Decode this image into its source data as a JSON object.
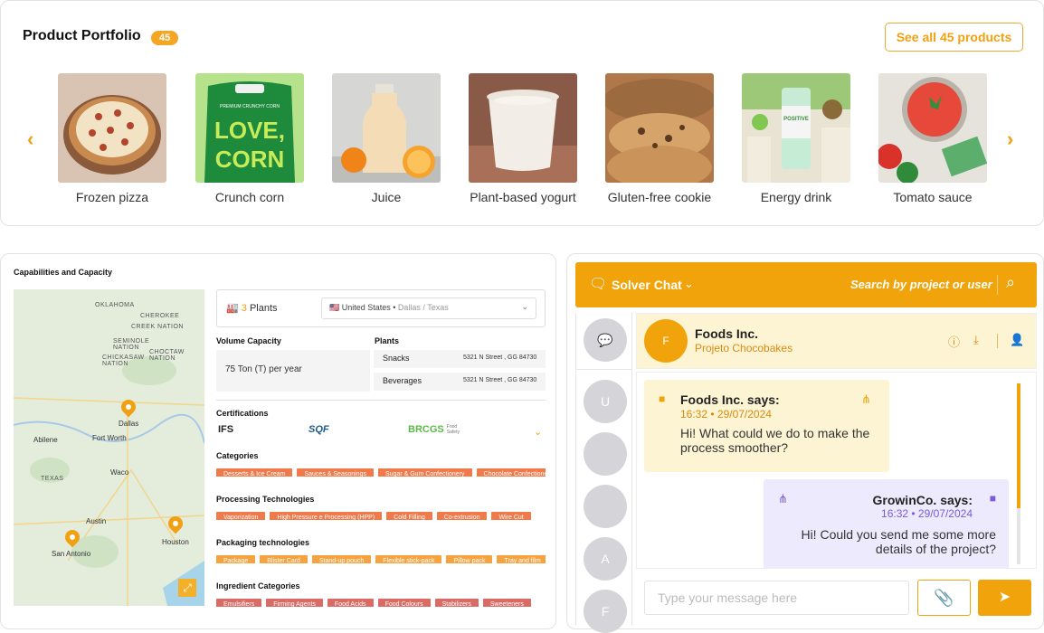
{
  "portfolio": {
    "title": "Product Portfolio",
    "count": "45",
    "see_all": "See all 45 products",
    "products": [
      {
        "label": "Frozen pizza"
      },
      {
        "label": "Crunch corn"
      },
      {
        "label": "Juice"
      },
      {
        "label": "Plant-based yogurt"
      },
      {
        "label": "Gluten-free cookie"
      },
      {
        "label": "Energy drink"
      },
      {
        "label": "Tomato sauce"
      }
    ],
    "corn_pack_text": "LOVE, CORN",
    "corn_pack_small": "PREMIUM CRUNCHY CORN",
    "drink_can_text": "POSITIVE BEVERAGE"
  },
  "capabilities": {
    "title": "Capabilities and Capacity",
    "plants_count": "3",
    "plants_label": "Plants",
    "country": "United States",
    "country_sub": "Dallas / Texas",
    "volume_header": "Volume Capacity",
    "volume_value": "75 Ton (T) per year",
    "plants_header": "Plants",
    "plants": [
      {
        "name": "Snacks",
        "addr": "5321 N  Street , GG 84730"
      },
      {
        "name": "Beverages",
        "addr": "5321 N  Street , GG 84730"
      }
    ],
    "certifications_header": "Certifications",
    "certifications": [
      "IFS",
      "SQF",
      "BRCGS"
    ],
    "brcgs_sub": "Food Safety",
    "categories_header": "Categories",
    "categories": [
      "Desserts & Ice Cream",
      "Sauces & Seasonings",
      "Sugar & Gum Confectionery",
      "Chocolate Confectionery"
    ],
    "processing_header": "Processing Technologies",
    "processing": [
      "Vaporization",
      "High Pressure e Processing (HPP)",
      "Cold Filling",
      "Co-extrusion",
      "Wire Cut"
    ],
    "packaging_header": "Packaging technologies",
    "packaging": [
      "Package",
      "Blister Card",
      "Stand-up pouch",
      "Flexible stick-pack",
      "Pillow pack",
      "Tray and film"
    ],
    "ingredient_header": "Ingredient Categories",
    "ingredients": [
      "Emulsifiers",
      "Firming Agents",
      "Food Acids",
      "Food Colours",
      "Stabilizers",
      "Sweeteners"
    ],
    "map_labels": {
      "oklahoma": "OKLAHOMA",
      "creek": "CREEK NATION",
      "cherokee": "CHEROKEE",
      "seminole": "SEMINOLE NATION",
      "chickasaw": "CHICKASAW NATION",
      "choctaw": "CHOCTAW NATION",
      "texas": "TEXAS",
      "dallas": "Dallas",
      "fortworth": "Fort Worth",
      "austin": "Austin",
      "sanantonio": "San Antonio",
      "houston": "Houston",
      "abilene": "Abilene",
      "waco": "Waco"
    }
  },
  "chat": {
    "title": "Solver Chat",
    "search_placeholder": "Search by project or user",
    "sidebar_avatars": [
      "U",
      "",
      "",
      "A",
      "F"
    ],
    "conversation": {
      "avatar": "F",
      "name": "Foods Inc.",
      "project": "Projeto Chocobakes"
    },
    "messages": [
      {
        "author": "Foods Inc. says:",
        "time": "16:32 • 29/07/2024",
        "text": "Hi! What could we do to make the process smoother?"
      },
      {
        "author": "GrowinCo. says:",
        "time": "16:32 • 29/07/2024",
        "text": "Hi! Could you send me some more details of the project?"
      }
    ],
    "input_placeholder": "Type your message here"
  },
  "colors": {
    "accent": "#f0a30a",
    "chip_orange": "#f07a4a",
    "chip_yellow": "#f4a340",
    "chip_red": "#d96a64"
  }
}
